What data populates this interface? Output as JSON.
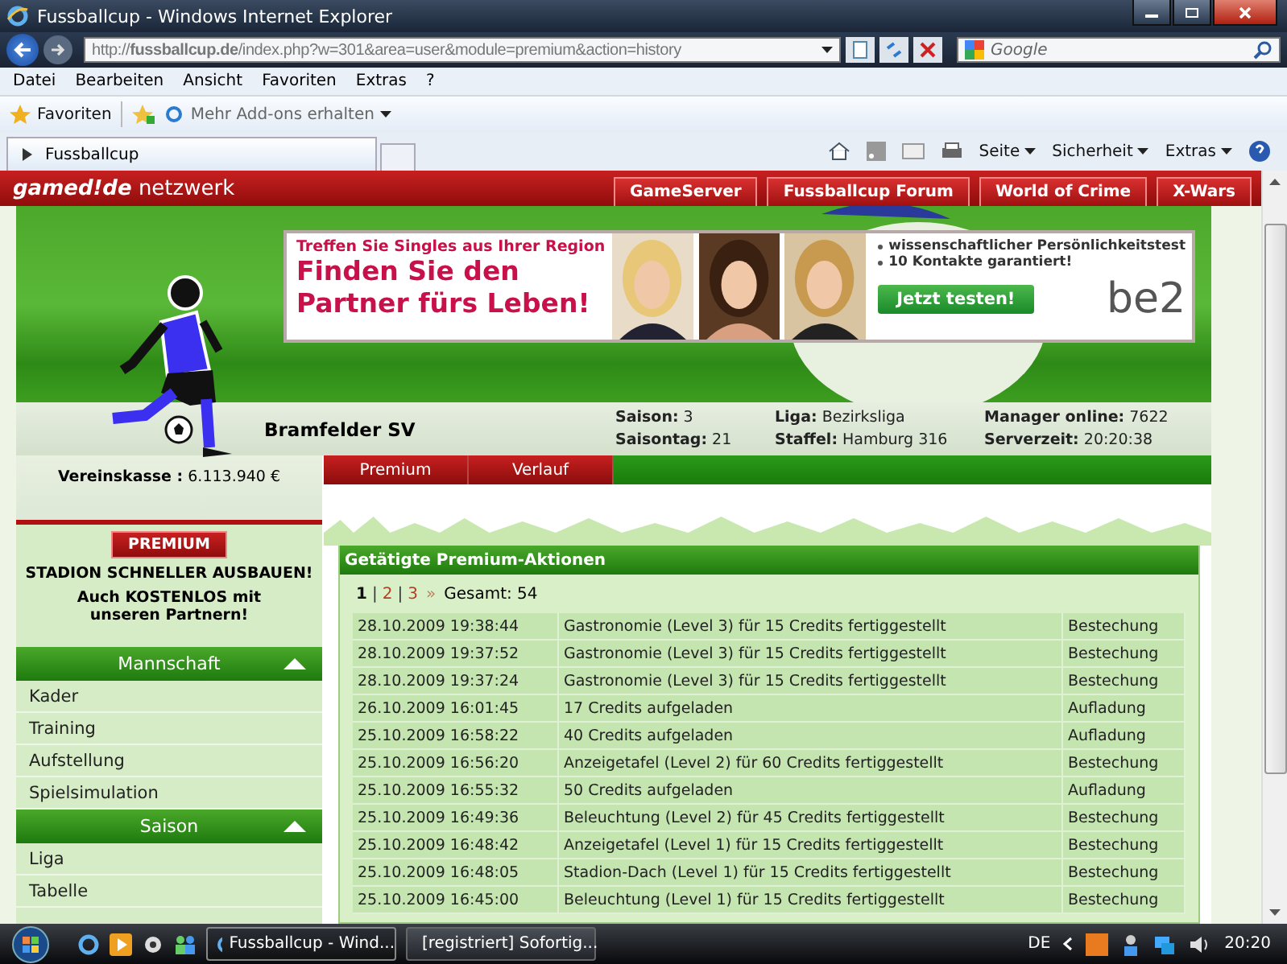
{
  "window": {
    "title": "Fussballcup - Windows Internet Explorer"
  },
  "address_bar": {
    "url": "http://**fussballcup.de**/index.php?w=301&area=user&module=premium&action=history"
  },
  "search": {
    "placeholder": "Google"
  },
  "menu": [
    "Datei",
    "Bearbeiten",
    "Ansicht",
    "Favoriten",
    "Extras",
    "?"
  ],
  "favorites_bar": {
    "favorites": "Favoriten",
    "addons": "Mehr Add-ons erhalten"
  },
  "tabs": [
    {
      "label": "Fussballcup",
      "selected": true
    }
  ],
  "command_bar": [
    "Seite",
    "Sicherheit",
    "Extras"
  ],
  "network_bar": {
    "brand": "gamed!de",
    "suffix": "netzwerk",
    "links": [
      "GameServer",
      "Fussballcup Forum",
      "World of Crime",
      "X-Wars"
    ]
  },
  "ad": {
    "kicker": "Treffen Sie Singles aus Ihrer Region",
    "headline": "Finden Sie den Partner fürs Leben!",
    "photos": [
      {
        "kind": "picture"
      },
      {
        "kind": "picture"
      },
      {
        "kind": "picture"
      }
    ],
    "bullets": [
      "wissenschaftlicher Persönlichkeitstest",
      "10 Kontakte garantiert!"
    ],
    "button": "Jetzt testen!",
    "logo": "be2"
  },
  "club": {
    "name": "Bramfelder SV"
  },
  "stats": [
    "**Saison:** 3",
    "**Liga:** Bezirksliga",
    "**Manager online:** 7622",
    "**Saisontag:** 21",
    "**Staffel:** Hamburg 316",
    "**Serverzeit:** 20:20:38"
  ],
  "sidebar": {
    "balance": "**Vereinskasse :** 6.113.940 €",
    "premium_button": "PREMIUM",
    "promo_title": "STADION SCHNELLER AUSBAUEN!",
    "promo_text": "Auch KOSTENLOS mit unseren Partnern!",
    "sections": [
      {
        "title": "Mannschaft",
        "expanded": true,
        "items": [
          "Kader",
          "Training",
          "Aufstellung",
          "Spielsimulation"
        ]
      },
      {
        "title": "Saison",
        "expanded": true,
        "items": [
          "Liga",
          "Tabelle"
        ]
      }
    ]
  },
  "content_tabs": [
    "Premium",
    "Verlauf"
  ],
  "panel": {
    "title": "Getätigte Premium-Aktionen",
    "pages": [
      {
        "label": "1",
        "selected": true
      },
      {
        "label": "2",
        "selected": false
      },
      {
        "label": "3",
        "selected": false
      }
    ],
    "separator": "|",
    "next": "»",
    "total": "Gesamt: 54",
    "rows": [
      {
        "date": "28.10.2009 19:38:44",
        "action": "Gastronomie (Level 3) für 15 Credits fertiggestellt",
        "type": "Bestechung"
      },
      {
        "date": "28.10.2009 19:37:52",
        "action": "Gastronomie (Level 3) für 15 Credits fertiggestellt",
        "type": "Bestechung"
      },
      {
        "date": "28.10.2009 19:37:24",
        "action": "Gastronomie (Level 3) für 15 Credits fertiggestellt",
        "type": "Bestechung"
      },
      {
        "date": "26.10.2009 16:01:45",
        "action": "17 Credits aufgeladen",
        "type": "Aufladung"
      },
      {
        "date": "25.10.2009 16:58:22",
        "action": "40 Credits aufgeladen",
        "type": "Aufladung"
      },
      {
        "date": "25.10.2009 16:56:20",
        "action": "Anzeigetafel (Level 2) für 60 Credits fertiggestellt",
        "type": "Bestechung"
      },
      {
        "date": "25.10.2009 16:55:32",
        "action": "50 Credits aufgeladen",
        "type": "Aufladung"
      },
      {
        "date": "25.10.2009 16:49:36",
        "action": "Beleuchtung (Level 2) für 45 Credits fertiggestellt",
        "type": "Bestechung"
      },
      {
        "date": "25.10.2009 16:48:42",
        "action": "Anzeigetafel (Level 1) für 15 Credits fertiggestellt",
        "type": "Bestechung"
      },
      {
        "date": "25.10.2009 16:48:05",
        "action": "Stadion-Dach (Level 1) für 15 Credits fertiggestellt",
        "type": "Bestechung"
      },
      {
        "date": "25.10.2009 16:45:00",
        "action": "Beleuchtung (Level 1) für 15 Credits fertiggestellt",
        "type": "Bestechung"
      }
    ]
  },
  "taskbar": {
    "tasks": [
      {
        "label": "Fussballcup - Wind...",
        "selected": true
      },
      {
        "label": "[registriert] Sofortig...",
        "selected": false
      }
    ],
    "language": "DE",
    "clock": "20:20"
  }
}
